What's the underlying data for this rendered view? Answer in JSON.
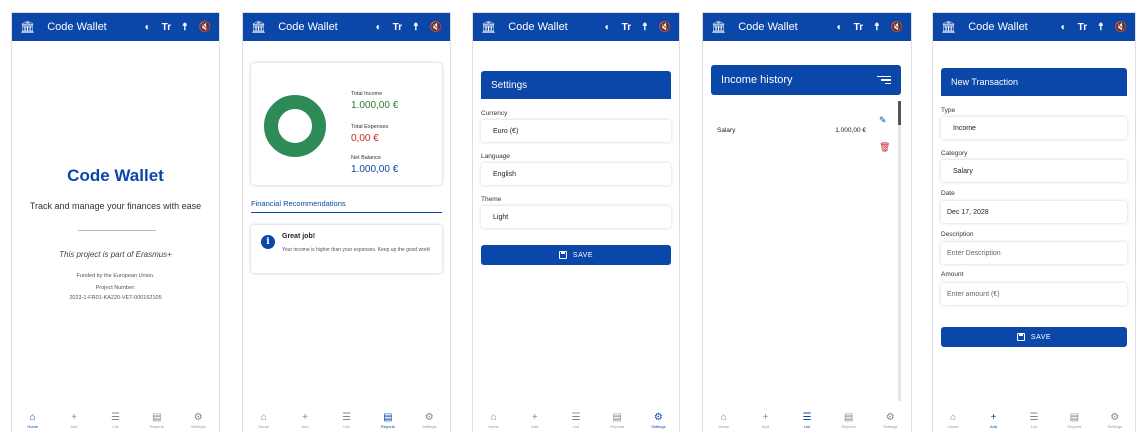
{
  "app_title": "Code Wallet",
  "icons": {
    "bank": "bank-icon",
    "contrast": "contrast-icon",
    "text_size": "text-size-icon",
    "accessibility": "accessibility-icon",
    "audio": "audio-off-icon"
  },
  "appbar": {
    "text_size": "Tr"
  },
  "colors": {
    "primary": "#0b47a8",
    "income": "#2e7d32",
    "expense": "#c62828",
    "donut": "#2e8b57"
  },
  "nav": {
    "home": "Home",
    "add": "Add",
    "list": "List",
    "reports": "Reports",
    "settings": "Settings"
  },
  "home": {
    "title": "Code Wallet",
    "subtitle": "Track and manage your finances with ease",
    "project": "This project is part of Erasmus+",
    "funded": "Funded by the European Union.",
    "project_number_label": "Project Number:",
    "project_number": "2023-1-FR01-KA220-VET-000162105"
  },
  "reports": {
    "total_income_label": "Total Income",
    "total_income": "1.000,00 €",
    "total_expenses_label": "Total Expenses",
    "total_expenses": "0,00 €",
    "net_balance_label": "Net Balance",
    "net_balance": "1.000,00 €",
    "income_share": 1.0,
    "recommendations_title": "Financial Recommendations",
    "rec_heading": "Great job!",
    "rec_text": "Your income is higher than your expenses. Keep up the good work!"
  },
  "settings": {
    "title": "Settings",
    "currency_label": "Currency",
    "currency_value": "Euro (€)",
    "language_label": "Language",
    "language_value": "English",
    "theme_label": "Theme",
    "theme_value": "Light",
    "save": "SAVE"
  },
  "history": {
    "title": "Income history",
    "rows": [
      {
        "name": "Salary",
        "amount": "1.000,00 €"
      }
    ]
  },
  "new_tx": {
    "title": "New Transaction",
    "type_label": "Type",
    "type_value": "Income",
    "category_label": "Category",
    "category_value": "Salary",
    "date_label": "Date",
    "date_value": "Dec 17, 2028",
    "description_label": "Description",
    "description_placeholder": "Enter Description",
    "amount_label": "Amount",
    "amount_placeholder": "Enter amount (€)",
    "save": "SAVE"
  }
}
